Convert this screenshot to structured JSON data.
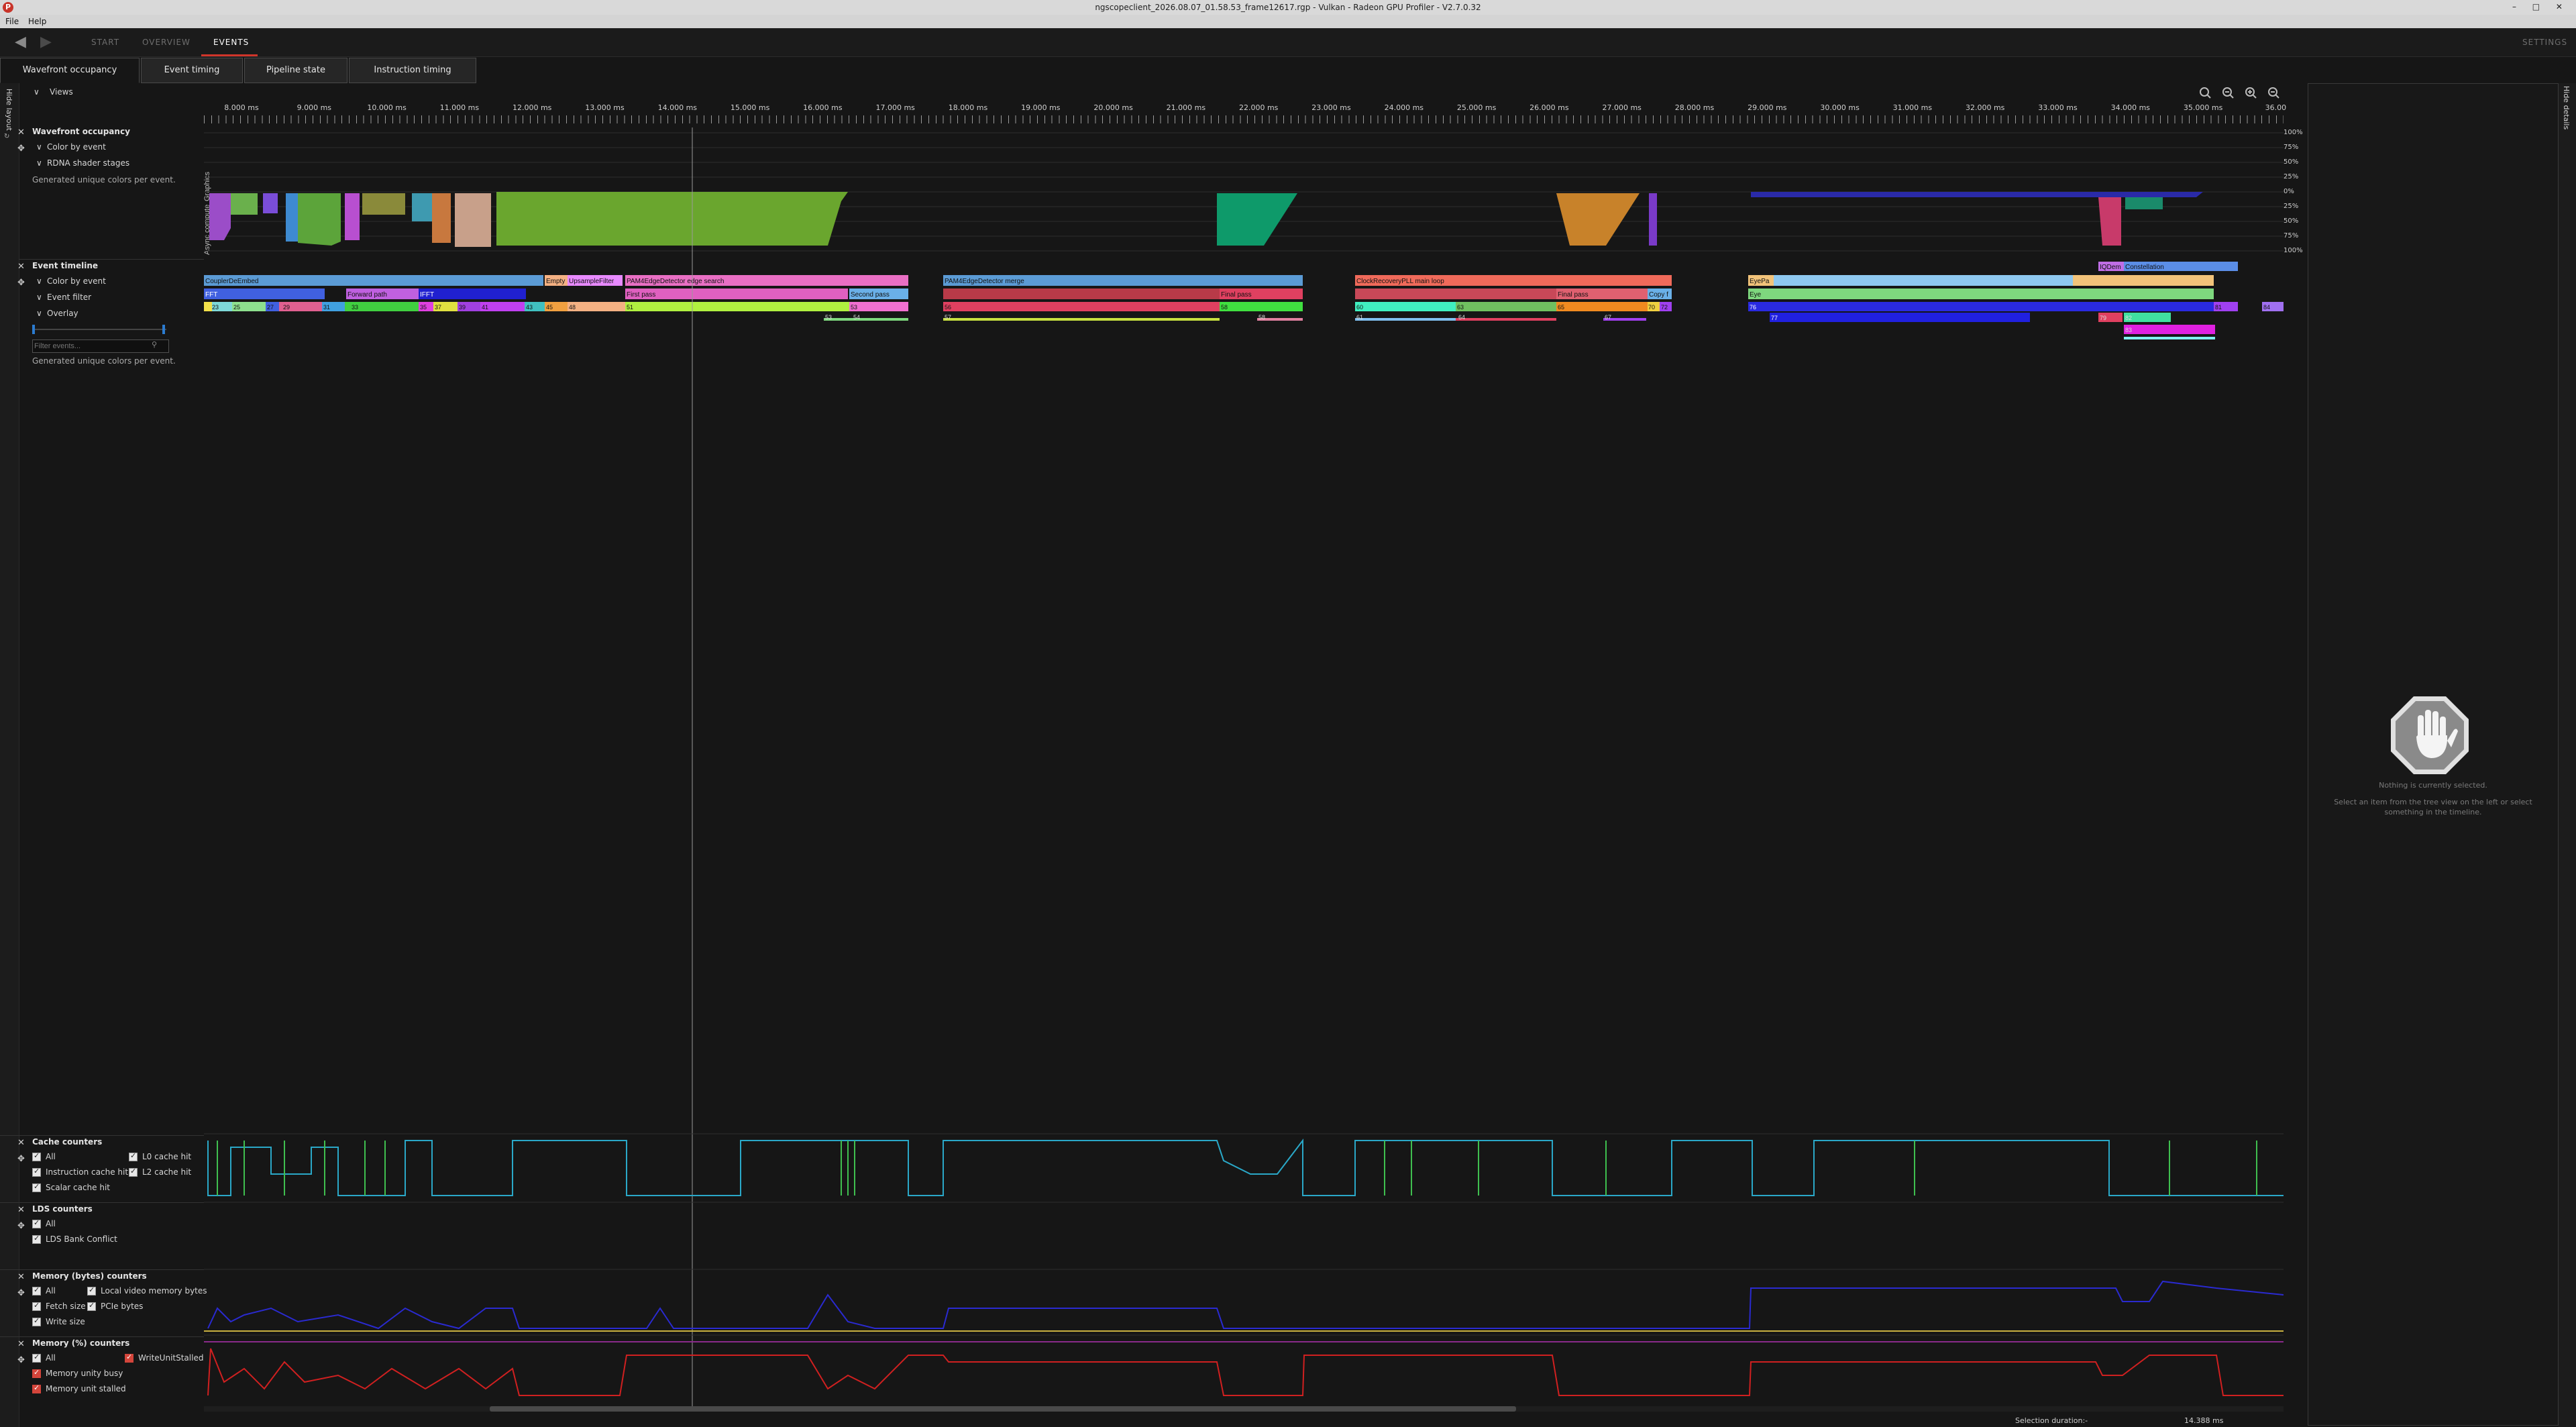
{
  "window": {
    "title": "ngscopeclient_2026.08.07_01.58.53_frame12617.rgp - Vulkan - Radeon GPU Profiler - V2.7.0.32",
    "app_icon_letter": "P",
    "controls": "– □ ✕"
  },
  "menu": [
    "File",
    "Help"
  ],
  "nav": {
    "back_icon": "◀",
    "forward_icon": "▶",
    "tabs": [
      "START",
      "OVERVIEW",
      "EVENTS"
    ],
    "active_tab": "EVENTS",
    "settings": "SETTINGS"
  },
  "subtabs": [
    "Wavefront occupancy",
    "Event timing",
    "Pipeline state",
    "Instruction timing"
  ],
  "left_strip": {
    "hide_layout": "Hide layout"
  },
  "right_strip": {
    "hide_details": "Hide details"
  },
  "views": {
    "label": "Views"
  },
  "wavefront_occupancy": {
    "title": "Wavefront occupancy",
    "color_by_event": "Color by event",
    "rdna_shader_stages": "RDNA shader stages",
    "note": "Generated unique colors per event."
  },
  "event_timeline": {
    "title": "Event timeline",
    "color_by_event": "Color by event",
    "event_filter": "Event filter",
    "overlay": "Overlay",
    "filter_placeholder": "Filter events...",
    "note": "Generated unique colors per event."
  },
  "cache_counters": {
    "title": "Cache counters",
    "items": [
      "All",
      "L0 cache hit",
      "Instruction cache hit",
      "L2 cache hit",
      "Scalar cache hit"
    ]
  },
  "lds_counters": {
    "title": "LDS counters",
    "items": [
      "All",
      "LDS Bank Conflict"
    ]
  },
  "memory_bytes_counters": {
    "title": "Memory (bytes) counters",
    "items": [
      "All",
      "Local video memory bytes",
      "Fetch size",
      "PCIe bytes",
      "Write size"
    ]
  },
  "memory_pct_counters": {
    "title": "Memory (%) counters",
    "items": [
      "All",
      "WriteUnitStalled",
      "Memory unity busy",
      "Memory unit stalled"
    ]
  },
  "ruler": {
    "labels": [
      "8.000 ms",
      "9.000 ms",
      "10.000 ms",
      "11.000 ms",
      "12.000 ms",
      "13.000 ms",
      "14.000 ms",
      "15.000 ms",
      "16.000 ms",
      "17.000 ms",
      "18.000 ms",
      "19.000 ms",
      "20.000 ms",
      "21.000 ms",
      "22.000 ms",
      "23.000 ms",
      "24.000 ms",
      "25.000 ms",
      "26.000 ms",
      "27.000 ms",
      "28.000 ms",
      "29.000 ms",
      "30.000 ms",
      "31.000 ms",
      "32.000 ms",
      "33.000 ms",
      "34.000 ms",
      "35.000 ms",
      "36.00"
    ]
  },
  "row_labels": {
    "graphics": "Graphics",
    "async_compute": "Async compute"
  },
  "occupancy_axis": [
    "100%",
    "75%",
    "50%",
    "25%",
    "0%",
    "25%",
    "50%",
    "75%",
    "100%"
  ],
  "events": {
    "level1": [
      {
        "label": "CouplerDeEmbed",
        "color": "#5b9bd5"
      },
      {
        "label": "Empty",
        "color": "#f4b183"
      },
      {
        "label": "UpsampleFilter",
        "color": "#e88aff"
      },
      {
        "label": "PAM4EdgeDetector edge search",
        "color": "#e96fc4"
      },
      {
        "label": "PAM4EdgeDetector merge",
        "color": "#5b9bd5"
      },
      {
        "label": "ClockRecoveryPLL main loop",
        "color": "#f06a5a"
      },
      {
        "label": "EyePa",
        "color": "#f2c37a"
      },
      {
        "label": "IQDem",
        "color": "#c06ee6"
      },
      {
        "label": "Constellation",
        "color": "#5b8ee6"
      }
    ],
    "level2": [
      {
        "label": "FFT",
        "color": "#4060e0"
      },
      {
        "label": "Forward path",
        "color": "#c060e0"
      },
      {
        "label": "IFFT",
        "color": "#2020d0"
      },
      {
        "label": "First pass",
        "color": "#e060c0"
      },
      {
        "label": "Second pass",
        "color": "#6ab0e8"
      },
      {
        "label": "Final pass",
        "color": "#e04060"
      },
      {
        "label": "Final pass",
        "color": "#e06070"
      },
      {
        "label": "Copy f",
        "color": "#6ab0e8"
      },
      {
        "label": "Eye",
        "color": "#7ed87e"
      }
    ],
    "ids_row3": [
      "23",
      "25",
      "27",
      "29",
      "31",
      "33",
      "35",
      "37",
      "39",
      "41",
      "43",
      "45",
      "48",
      "51",
      "53",
      "56",
      "58",
      "60",
      "63",
      "65",
      "70",
      "72",
      "76",
      "81",
      "84"
    ],
    "ids_row4": [
      "53",
      "54",
      "57",
      "58",
      "61",
      "64",
      "67",
      "77",
      "79",
      "82",
      "83"
    ]
  },
  "details": {
    "empty_title": "Nothing is currently selected.",
    "empty_hint": "Select an item from the tree view on the left or select something in the timeline.",
    "icon": "stop-hand-icon"
  },
  "status": {
    "selection_label": "Selection duration:-",
    "selection_value": "14.388 ms"
  },
  "colors": {
    "accent": "#d0352a",
    "panel_bg": "#161616",
    "counter_cyan": "#2aa8c8",
    "counter_green": "#3fbf4f",
    "memory_blue": "#2a2ad0",
    "memory_red": "#d02020"
  }
}
